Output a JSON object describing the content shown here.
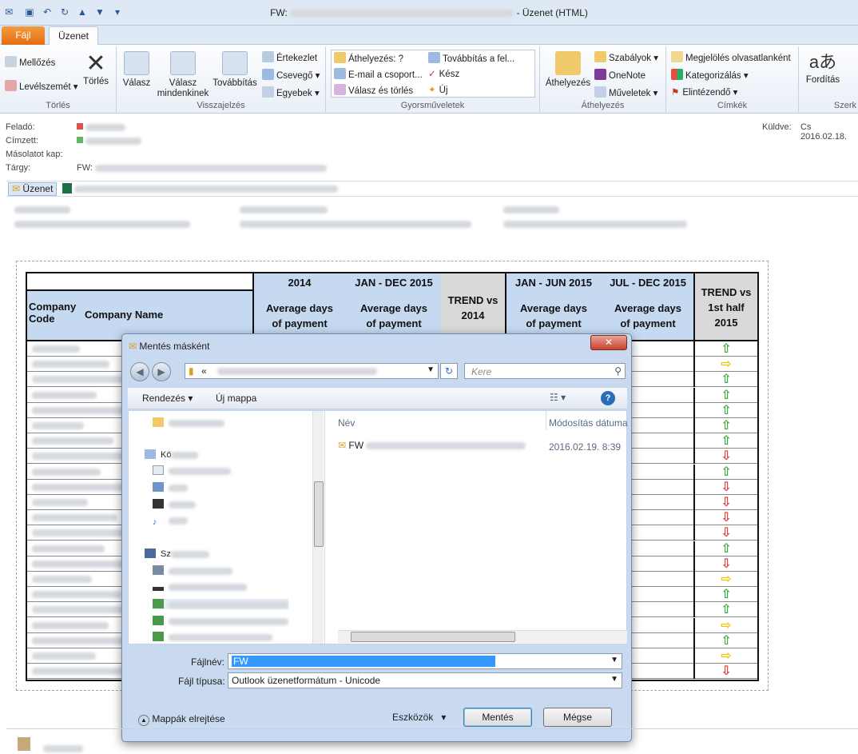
{
  "window": {
    "title": "FW:",
    "title_suffix": "-  Üzenet (HTML)"
  },
  "tabs": {
    "file": "Fájl",
    "message": "Üzenet"
  },
  "ribbon": {
    "delete_group": {
      "ignore": "Mellőzés",
      "junk": "Levélszemét",
      "delete": "Törlés",
      "label": "Törlés"
    },
    "respond_group": {
      "reply": "Válasz",
      "reply_all": "Válasz mindenkinek",
      "forward": "Továbbítás",
      "meeting": "Értekezlet",
      "chat": "Csevegő",
      "more": "Egyebek",
      "label": "Visszajelzés"
    },
    "quick_steps": {
      "move_to": "Áthelyezés: ?",
      "forward_to": "Továbbítás a fel...",
      "team_email": "E-mail a csoport...",
      "done": "Kész",
      "reply_delete": "Válasz és törlés",
      "new": "Új",
      "label": "Gyorsműveletek"
    },
    "move_group": {
      "move": "Áthelyezés",
      "rules": "Szabályok",
      "onenote": "OneNote",
      "actions": "Műveletek",
      "label": "Áthelyezés"
    },
    "tags_group": {
      "mark_unread": "Megjelölés olvasatlanként",
      "categorize": "Kategorizálás",
      "follow_up": "Elintézendő",
      "label": "Címkék"
    },
    "editing_group": {
      "translate": "Fordítás",
      "label": "Szerk"
    }
  },
  "header": {
    "from_label": "Feladó:",
    "to_label": "Címzett:",
    "cc_label": "Másolatot kap:",
    "subject_label": "Tárgy:",
    "subject_prefix": "FW:",
    "sent_label": "Küldve:",
    "sent_value": "Cs 2016.02.18."
  },
  "attachments": {
    "message_tab": "Üzenet"
  },
  "table": {
    "col_code": "Company Code",
    "col_name": "Company Name",
    "y2014": "2014",
    "jandec2015": "JAN - DEC 2015",
    "trend_vs_2014": "TREND vs 2014",
    "janjun2015": "JAN - JUN 2015",
    "juldec2015": "JUL - DEC 2015",
    "trend_vs_h1": "TREND vs 1st half 2015",
    "avg_days": "Average days of payment",
    "arrows": [
      "up",
      "right",
      "up",
      "up",
      "up",
      "up",
      "up",
      "down",
      "up",
      "down",
      "down",
      "down",
      "down",
      "up",
      "down",
      "right",
      "up",
      "up",
      "right",
      "up",
      "right",
      "down"
    ]
  },
  "dialog": {
    "title": "Mentés másként",
    "path_prefix": "«",
    "search_placeholder": "Kere",
    "organize": "Rendezés",
    "new_folder": "Új mappa",
    "col_name": "Név",
    "col_modified": "Módosítás dátuma",
    "file_name": "FW",
    "file_modified": "2016.02.19. 8:39",
    "tree": {
      "item1": "",
      "libraries": "Kö",
      "computer": "Sz"
    },
    "filename_label": "Fájlnév:",
    "filename_value": "FW",
    "filetype_label": "Fájl típusa:",
    "filetype_value": "Outlook üzenetformátum - Unicode",
    "hide_folders": "Mappák elrejtése",
    "tools": "Eszközök",
    "save": "Mentés",
    "cancel": "Mégse"
  },
  "colors": {
    "ribbon_bg": "#e9eff7",
    "file_tab": "#e46d10",
    "header_blue": "#c5d9f1",
    "trend_gray": "#d9d9d9",
    "up_green": "#3aa83a",
    "down_red": "#e23b3b",
    "right_yellow": "#f5c400"
  }
}
